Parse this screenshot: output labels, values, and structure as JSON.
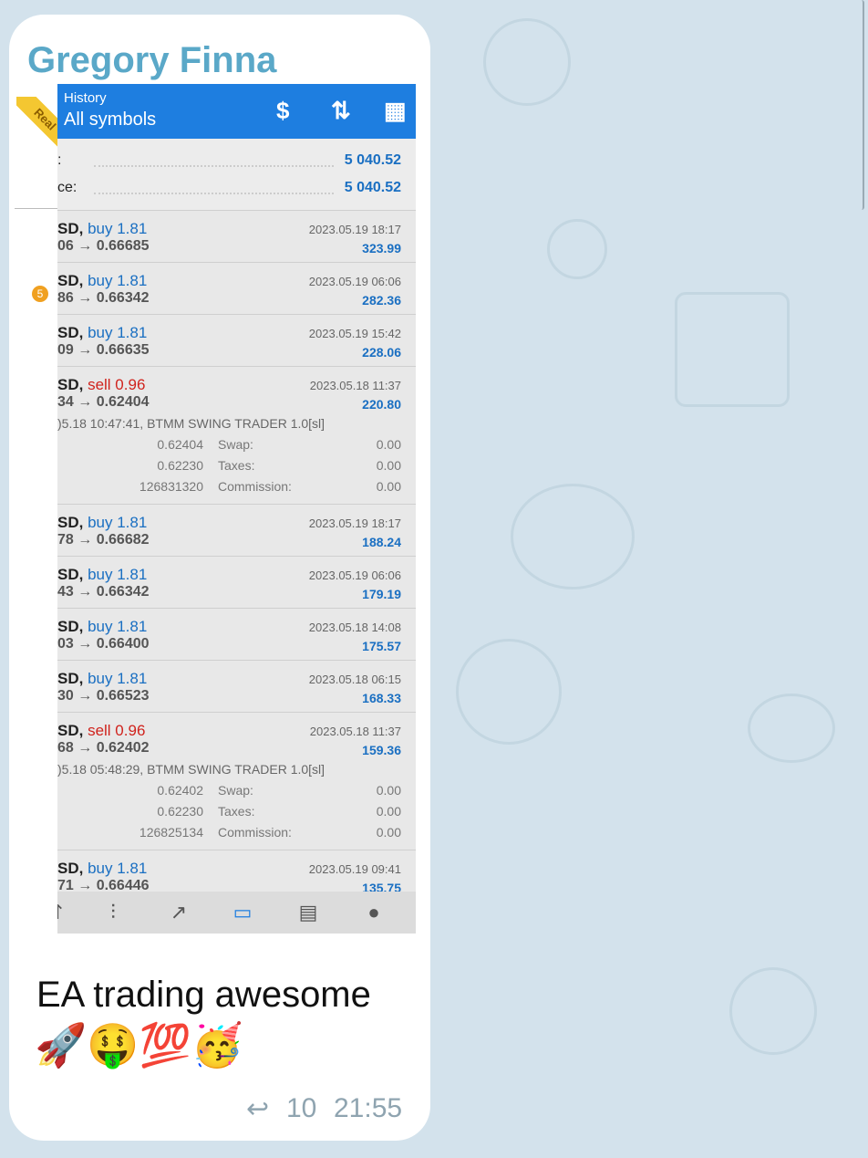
{
  "message": {
    "sender": "Gregory Finna",
    "text": "EA trading awesome",
    "emoji": "🚀🤑💯🥳",
    "replies": "10",
    "time": "21:55"
  },
  "app": {
    "ribbon": "Real",
    "header_small": "History",
    "header_big": "All symbols",
    "icons": [
      "dollar-swap-icon",
      "sort-icon",
      "calendar-icon"
    ],
    "badge": "5",
    "balances": [
      {
        "label": ":",
        "value": "5 040.52"
      },
      {
        "label": "ce:",
        "value": "5 040.52"
      }
    ],
    "deals": [
      {
        "sym": "SD,",
        "side": "buy 1.81",
        "type": "buy",
        "price": "06 → 0.66685",
        "time": "2023.05.19 18:17",
        "profit": "323.99"
      },
      {
        "sym": "SD,",
        "side": "buy 1.81",
        "type": "buy",
        "price": "86 → 0.66342",
        "time": "2023.05.19 06:06",
        "profit": "282.36"
      },
      {
        "sym": "SD,",
        "side": "buy 1.81",
        "type": "buy",
        "price": "09 → 0.66635",
        "time": "2023.05.19 15:42",
        "profit": "228.06"
      },
      {
        "sym": "SD,",
        "side": "sell 0.96",
        "type": "sell",
        "price": "34 → 0.62404",
        "time": "2023.05.18 11:37",
        "profit": "220.80",
        "comment": ")5.18 10:47:41, BTMM SWING TRADER 1.0[sl]",
        "extra": [
          [
            "0.62404",
            "Swap:",
            "0.00"
          ],
          [
            "0.62230",
            "Taxes:",
            "0.00"
          ],
          [
            "126831320",
            "Commission:",
            "0.00"
          ]
        ]
      },
      {
        "sym": "SD,",
        "side": "buy 1.81",
        "type": "buy",
        "price": "78 → 0.66682",
        "time": "2023.05.19 18:17",
        "profit": "188.24"
      },
      {
        "sym": "SD,",
        "side": "buy 1.81",
        "type": "buy",
        "price": "43 → 0.66342",
        "time": "2023.05.19 06:06",
        "profit": "179.19"
      },
      {
        "sym": "SD,",
        "side": "buy 1.81",
        "type": "buy",
        "price": "03 → 0.66400",
        "time": "2023.05.18 14:08",
        "profit": "175.57"
      },
      {
        "sym": "SD,",
        "side": "buy 1.81",
        "type": "buy",
        "price": "30 → 0.66523",
        "time": "2023.05.18 06:15",
        "profit": "168.33"
      },
      {
        "sym": "SD,",
        "side": "sell 0.96",
        "type": "sell",
        "price": "68 → 0.62402",
        "time": "2023.05.18 11:37",
        "profit": "159.36",
        "comment": ")5.18 05:48:29, BTMM SWING TRADER 1.0[sl]",
        "extra": [
          [
            "0.62402",
            "Swap:",
            "0.00"
          ],
          [
            "0.62230",
            "Taxes:",
            "0.00"
          ],
          [
            "126825134",
            "Commission:",
            "0.00"
          ]
        ]
      },
      {
        "sym": "SD,",
        "side": "buy 1.81",
        "type": "buy",
        "price": "71 → 0.66446",
        "time": "2023.05.19 09:41",
        "profit": "135.75"
      }
    ],
    "tabs": [
      "quotes-icon",
      "chart-candles-icon",
      "trade-icon",
      "history-icon",
      "news-icon",
      "messages-icon"
    ]
  }
}
